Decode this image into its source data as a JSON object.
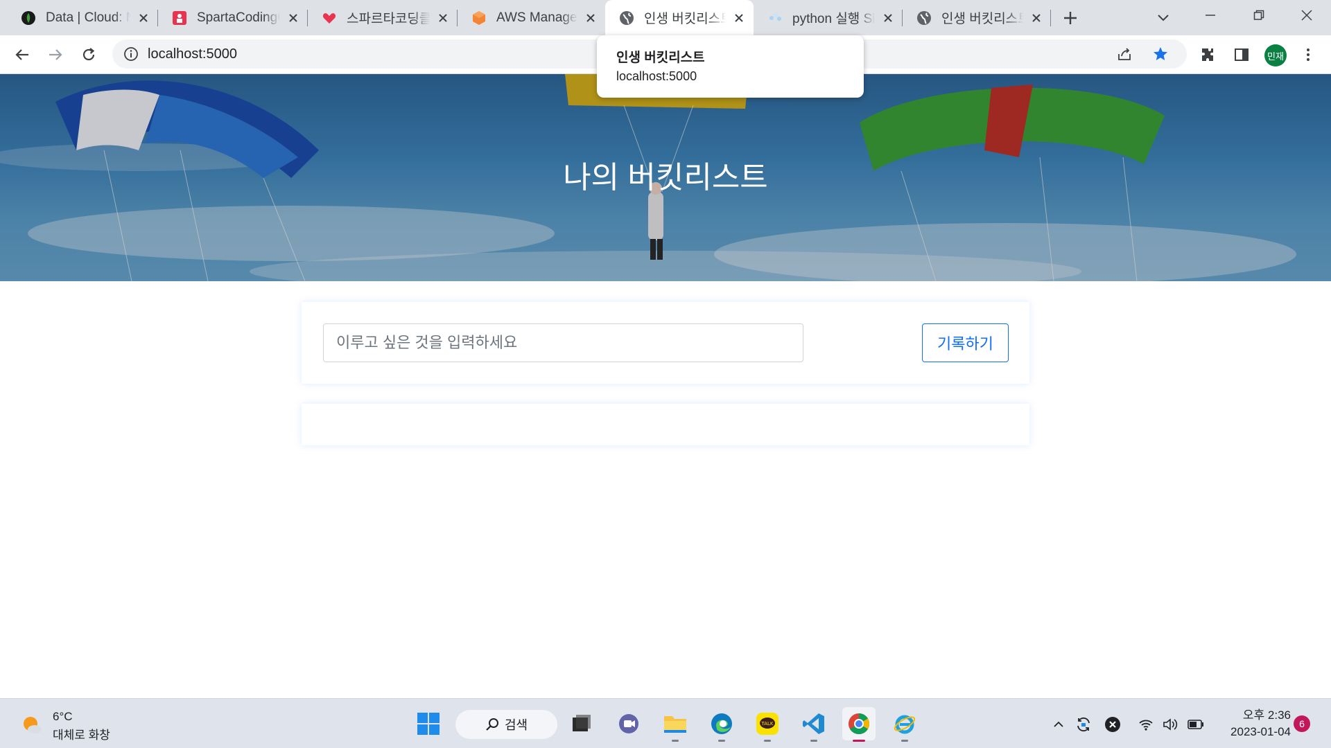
{
  "browser": {
    "tabs": [
      {
        "title": "Data | Cloud: MongoDB",
        "icon": "mongodb-leaf-icon"
      },
      {
        "title": "SpartaCodingClub",
        "icon": "sparta-icon"
      },
      {
        "title": "스파르타코딩클럽",
        "icon": "sparta-heart-icon"
      },
      {
        "title": "AWS Management Console",
        "icon": "aws-icon"
      },
      {
        "title": "인생 버킷리스트",
        "icon": "globe-icon",
        "active": true
      },
      {
        "title": "python 실행 Slack",
        "icon": "python-icon"
      },
      {
        "title": "인생 버킷리스트",
        "icon": "globe-icon"
      }
    ],
    "url": "localhost:5000",
    "profile_initials": "민재",
    "hover_card": {
      "title": "인생 버킷리스트",
      "url": "localhost:5000"
    }
  },
  "page": {
    "hero_title": "나의 버킷리스트",
    "input_placeholder": "이루고 싶은 것을 입력하세요",
    "save_button": "기록하기"
  },
  "taskbar": {
    "weather_temp": "6°C",
    "weather_condition": "대체로 화창",
    "search_label": "검색",
    "time": "오후 2:36",
    "date": "2023-01-04",
    "notification_count": "6"
  },
  "colors": {
    "accent_blue": "#0d6efd",
    "tab_strip": "#dee1e6",
    "profile": "#0b8043",
    "notification": "#c2185b"
  }
}
